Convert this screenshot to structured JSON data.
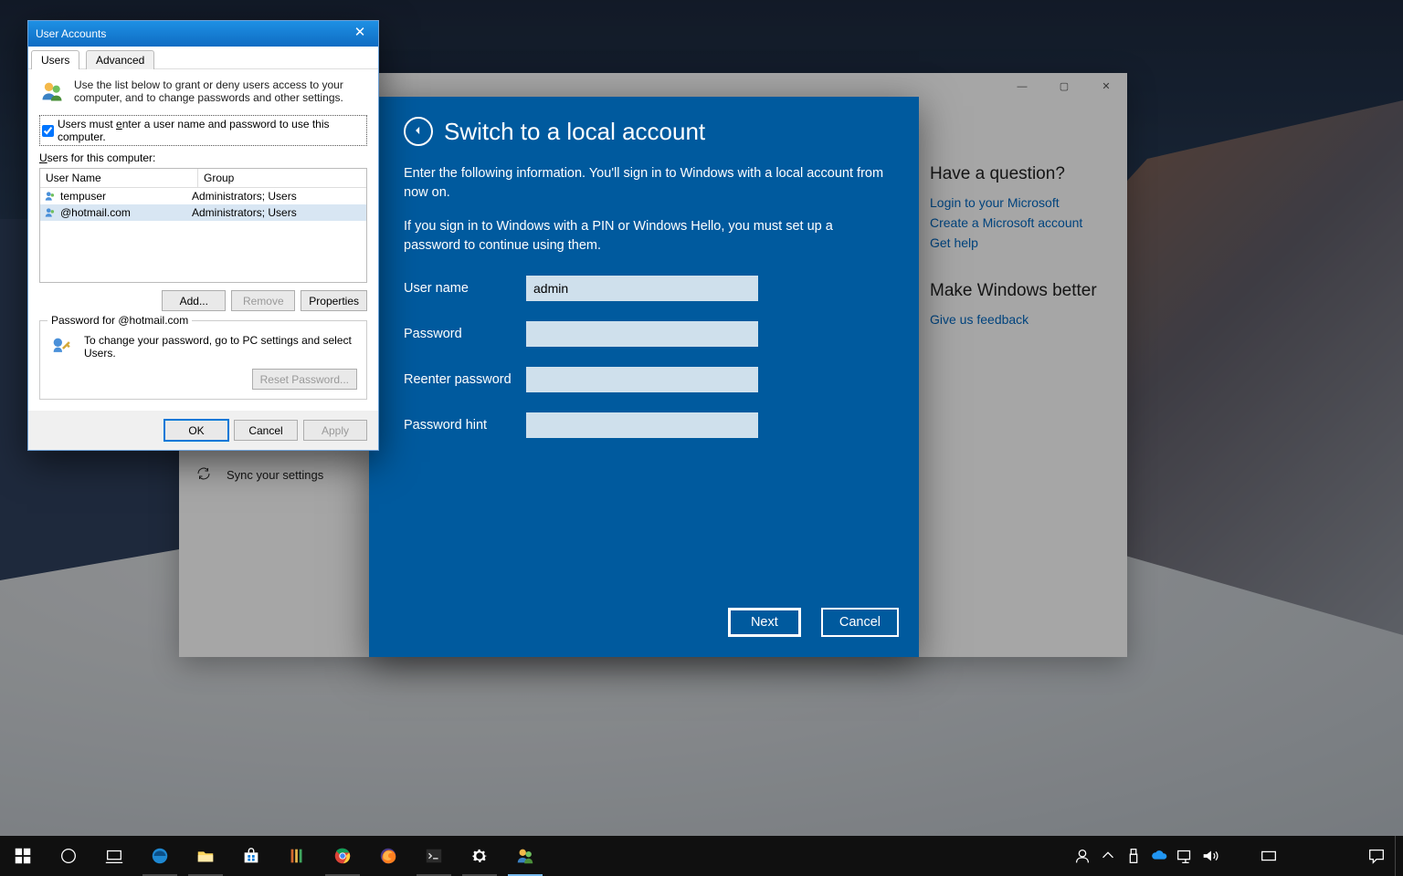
{
  "desktop": {},
  "settings_window": {
    "sys": {
      "min": "—",
      "max": "▢",
      "close": "✕"
    },
    "sidebar": {
      "sync": "Sync your settings"
    },
    "right": {
      "question_heading": "Have a question?",
      "link_login": "Login to your Microsoft",
      "link_create": "Create a Microsoft account",
      "link_help": "Get help",
      "improve_heading": "Make Windows better",
      "link_feedback": "Give us feedback"
    }
  },
  "switch_modal": {
    "title": "Switch to a local account",
    "p1": "Enter the following information. You'll sign in to Windows with a local account from now on.",
    "p2": "If you sign in to Windows with a PIN or Windows Hello, you must set up a password to continue using them.",
    "labels": {
      "username": "User name",
      "password": "Password",
      "reenter": "Reenter password",
      "hint": "Password hint"
    },
    "values": {
      "username": "admin",
      "password": "",
      "reenter": "",
      "hint": ""
    },
    "buttons": {
      "next": "Next",
      "cancel": "Cancel"
    }
  },
  "ua_dialog": {
    "title": "User Accounts",
    "tabs": {
      "users": "Users",
      "advanced": "Advanced"
    },
    "intro": "Use the list below to grant or deny users access to your computer, and to change passwords and other settings.",
    "checkbox_label": "Users must enter a user name and password to use this computer.",
    "checkbox_checked": true,
    "list_label": "Users for this computer:",
    "columns": {
      "name": "User Name",
      "group": "Group"
    },
    "rows": [
      {
        "name": "tempuser",
        "group": "Administrators; Users",
        "selected": false
      },
      {
        "name": "    @hotmail.com",
        "group": "Administrators; Users",
        "selected": true
      }
    ],
    "buttons": {
      "add": "Add...",
      "remove": "Remove",
      "properties": "Properties"
    },
    "password_group": {
      "title": "Password for               @hotmail.com",
      "text": "To change your password, go to PC settings and select Users.",
      "reset": "Reset Password..."
    },
    "footer": {
      "ok": "OK",
      "cancel": "Cancel",
      "apply": "Apply"
    }
  },
  "taskbar": {
    "clock_time": "",
    "clock_date": ""
  }
}
